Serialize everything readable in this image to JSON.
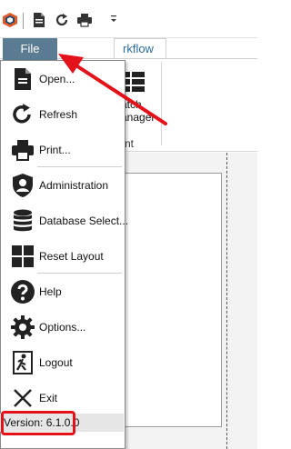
{
  "qat": {
    "icons": [
      "app-logo-icon",
      "document-icon",
      "refresh-icon",
      "print-icon",
      "customize-dropdown-icon"
    ]
  },
  "ribbon": {
    "file_tab_label": "File",
    "partial_tab_label": "rkflow",
    "button_label_line1": "atch",
    "button_label_line2": "anager",
    "group_label": "nt"
  },
  "file_menu": {
    "items": [
      {
        "label": "Open...",
        "icon": "open-document-icon"
      },
      {
        "label": "Refresh",
        "icon": "refresh-icon"
      },
      {
        "label": "Print...",
        "icon": "print-icon"
      },
      {
        "label": "Administration",
        "icon": "administration-shield-icon"
      },
      {
        "label": "Database Select...",
        "icon": "database-icon"
      },
      {
        "label": "Reset Layout",
        "icon": "layout-grid-icon"
      },
      {
        "label": "Help",
        "icon": "help-icon"
      },
      {
        "label": "Options...",
        "icon": "gear-icon"
      },
      {
        "label": "Logout",
        "icon": "logout-door-icon"
      },
      {
        "label": "Exit",
        "icon": "close-icon"
      }
    ],
    "version": "Version: 6.1.0.0"
  },
  "annotations": {
    "highlight_color": "#e3121a",
    "accent_color": "#5a7b92"
  }
}
